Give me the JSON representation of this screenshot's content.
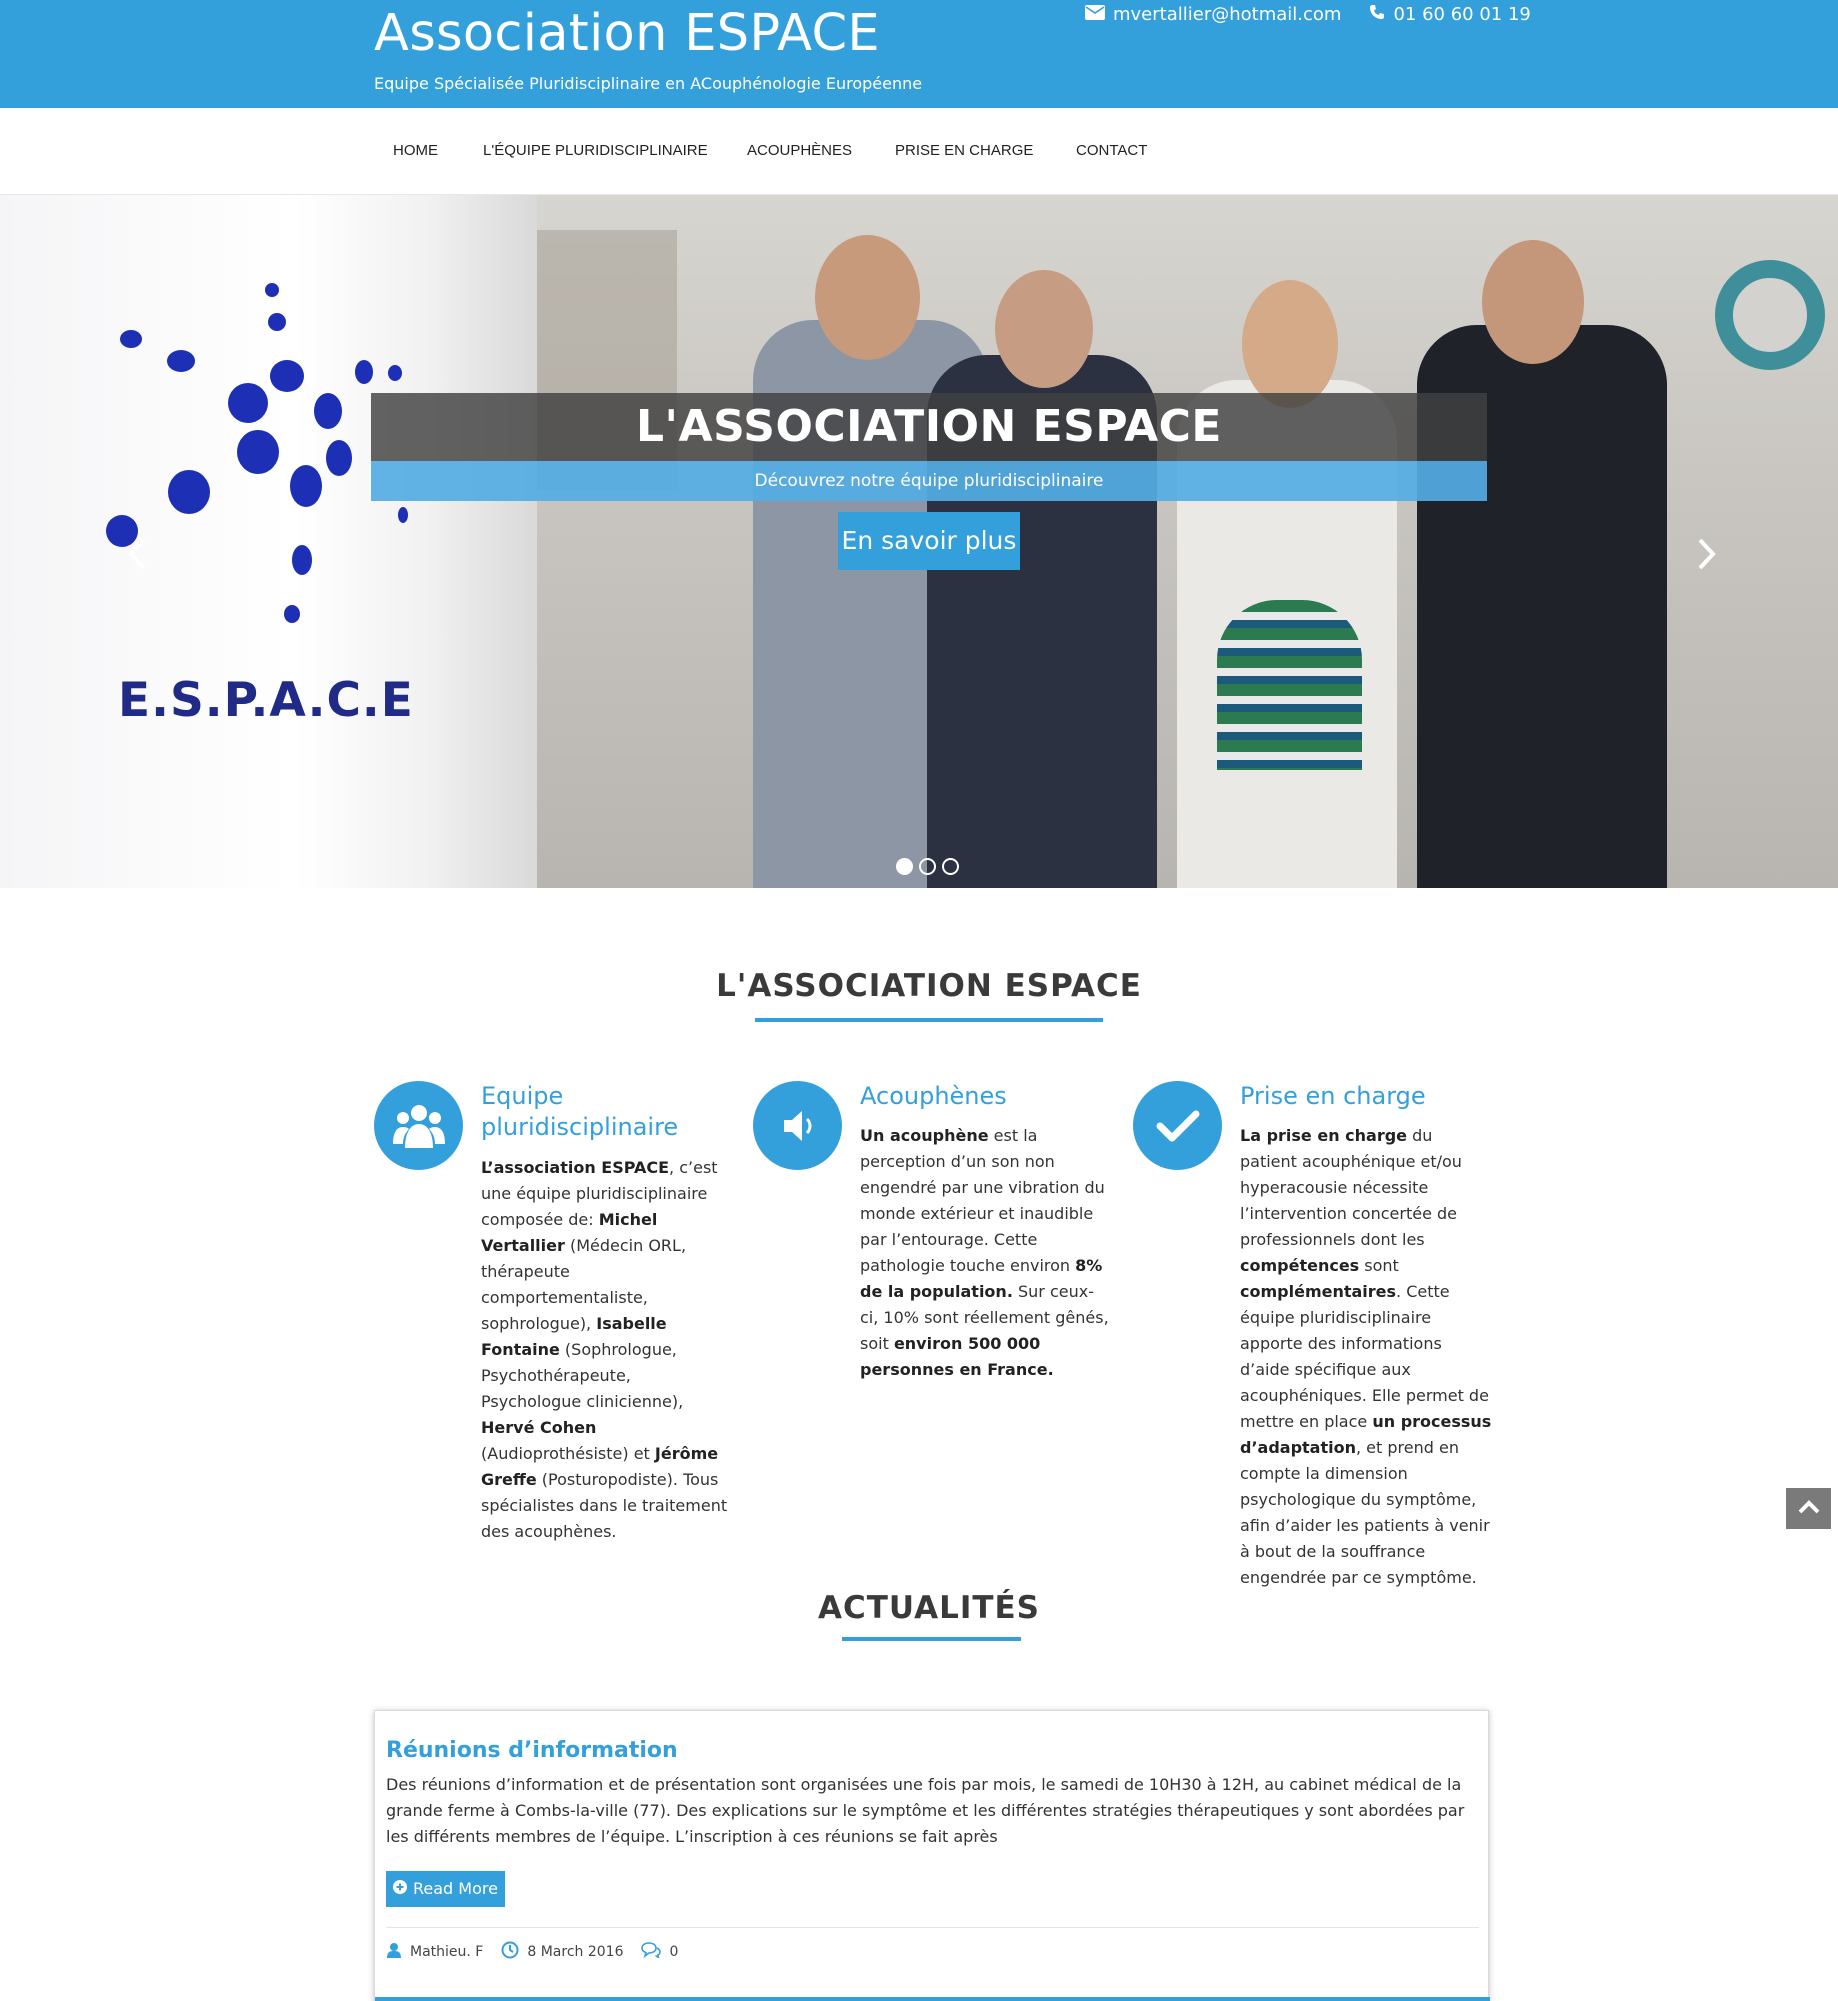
{
  "header": {
    "title": "Association ESPACE",
    "tagline": "Equipe Spécialisée Pluridisciplinaire en ACouphénologie Européenne",
    "email": "mvertallier@hotmail.com",
    "phone": "01 60 60 01 19",
    "email_icon": "envelope-icon",
    "phone_icon": "phone-icon"
  },
  "nav": {
    "items": [
      {
        "label": "HOME"
      },
      {
        "label": "L'ÉQUIPE PLURIDISCIPLINAIRE"
      },
      {
        "label": "ACOUPHÈNES"
      },
      {
        "label": "PRISE EN CHARGE"
      },
      {
        "label": "CONTACT"
      }
    ]
  },
  "hero": {
    "logo_text": "E.S.P.A.C.E",
    "title": "L'ASSOCIATION ESPACE",
    "subtitle": "Découvrez notre équipe pluridisciplinaire",
    "button": "En savoir plus",
    "prev_icon": "chevron-left-icon",
    "next_icon": "chevron-right-icon",
    "slides_total": 3,
    "active_slide": 1
  },
  "about": {
    "heading": "L'ASSOCIATION ESPACE",
    "features": [
      {
        "icon": "users-icon",
        "title": "Equipe pluridisciplinaire",
        "html_parts": [
          {
            "b": "L’association ESPACE"
          },
          {
            "t": ", c’est une équipe pluridisciplinaire composée de: "
          },
          {
            "b": "Michel Vertallier"
          },
          {
            "t": " (Médecin ORL, thérapeute comportementaliste, sophrologue), "
          },
          {
            "b": "Isabelle Fontaine"
          },
          {
            "t": " (Sophrologue, Psychothérapeute, Psychologue clinicienne), "
          },
          {
            "b": "Hervé Cohen"
          },
          {
            "t": " (Audioprothésiste) et "
          },
          {
            "b": "Jérôme Greffe"
          },
          {
            "t": " (Posturopodiste). Tous spécialistes dans le traitement des acouphènes."
          }
        ]
      },
      {
        "icon": "volume-icon",
        "title": "Acouphènes",
        "html_parts": [
          {
            "b": "Un acouphène"
          },
          {
            "t": " est la perception d’un son non engendré par une vibration du monde extérieur et inaudible par l’entourage. Cette pathologie touche environ "
          },
          {
            "b": "8% de la population."
          },
          {
            "t": " Sur ceux-ci, 10% sont réellement gênés, soit "
          },
          {
            "b": "environ 500 000 personnes en France."
          }
        ]
      },
      {
        "icon": "check-icon",
        "title": "Prise en charge",
        "html_parts": [
          {
            "b": "La prise en charge"
          },
          {
            "t": " du patient acouphénique et/ou hyperacousie nécessite l’intervention concertée de professionnels dont les "
          },
          {
            "b": "compétences"
          },
          {
            "t": " sont "
          },
          {
            "b": "complémentaires"
          },
          {
            "t": ". Cette équipe pluridisciplinaire apporte des informations d’aide spécifique aux acouphéniques. Elle permet de mettre en place "
          },
          {
            "b": "un processus d’adaptation"
          },
          {
            "t": ", et prend en compte la dimension psychologique du symptôme, afin d’aider les patients à venir à bout de la souffrance engendrée par ce symptôme."
          }
        ]
      }
    ]
  },
  "news": {
    "heading": "ACTUALITÉS",
    "post": {
      "title": "Réunions d’information",
      "excerpt": "Des réunions d’information et de présentation sont organisées une fois par mois, le samedi de 10H30 à 12H, au cabinet médical de la grande ferme à Combs-la-ville (77). Des explications sur le symptôme et les différentes stratégies thérapeutiques y sont abordées par les différents membres de l’équipe.   L’inscription à ces réunions se fait après",
      "read_more": "Read More",
      "author": "Mathieu. F",
      "date": "8 March 2016",
      "comments": "0"
    }
  },
  "colors": {
    "brand": "#33a0dc",
    "heading": "#3a3a3a"
  },
  "scroll_top_icon": "chevron-up-icon"
}
